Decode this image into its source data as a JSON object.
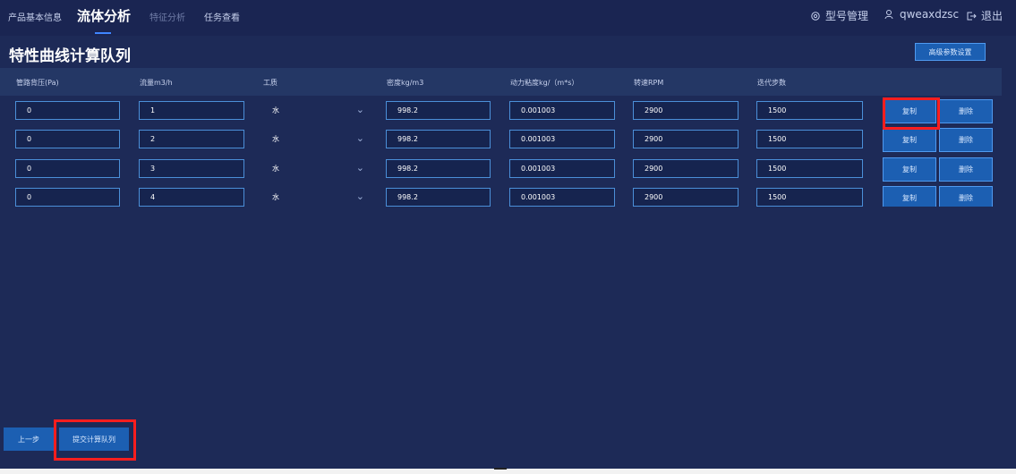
{
  "nav": {
    "tabs": [
      {
        "label": "产品基本信息"
      },
      {
        "label": "流体分析"
      },
      {
        "label": "特征分析"
      },
      {
        "label": "任务查看"
      }
    ],
    "model_mgmt": "型号管理",
    "username": "qweaxdzsc",
    "logout": "退出"
  },
  "page": {
    "title": "特性曲线计算队列",
    "advanced_settings": "高级参数设置"
  },
  "table": {
    "columns": [
      "管路背压(Pa)",
      "流量m3/h",
      "工质",
      "密度kg/m3",
      "动力粘度kg/（m*s）",
      "转速RPM",
      "迭代步数"
    ],
    "rows": [
      {
        "pressure": "0",
        "flow": "1",
        "medium": "水",
        "density": "998.2",
        "viscosity": "0.001003",
        "rpm": "2900",
        "steps": "1500",
        "copy": "复制",
        "delete": "删除"
      },
      {
        "pressure": "0",
        "flow": "2",
        "medium": "水",
        "density": "998.2",
        "viscosity": "0.001003",
        "rpm": "2900",
        "steps": "1500",
        "copy": "复制",
        "delete": "删除"
      },
      {
        "pressure": "0",
        "flow": "3",
        "medium": "水",
        "density": "998.2",
        "viscosity": "0.001003",
        "rpm": "2900",
        "steps": "1500",
        "copy": "复制",
        "delete": "删除"
      },
      {
        "pressure": "0",
        "flow": "4",
        "medium": "水",
        "density": "998.2",
        "viscosity": "0.001003",
        "rpm": "2900",
        "steps": "1500",
        "copy": "复制",
        "delete": "删除"
      }
    ]
  },
  "footer": {
    "prev": "上一步",
    "submit": "提交计算队列"
  },
  "colors": {
    "background": "#1d2a57",
    "accent": "#1c5fb2",
    "highlight": "#ff1e1e"
  }
}
